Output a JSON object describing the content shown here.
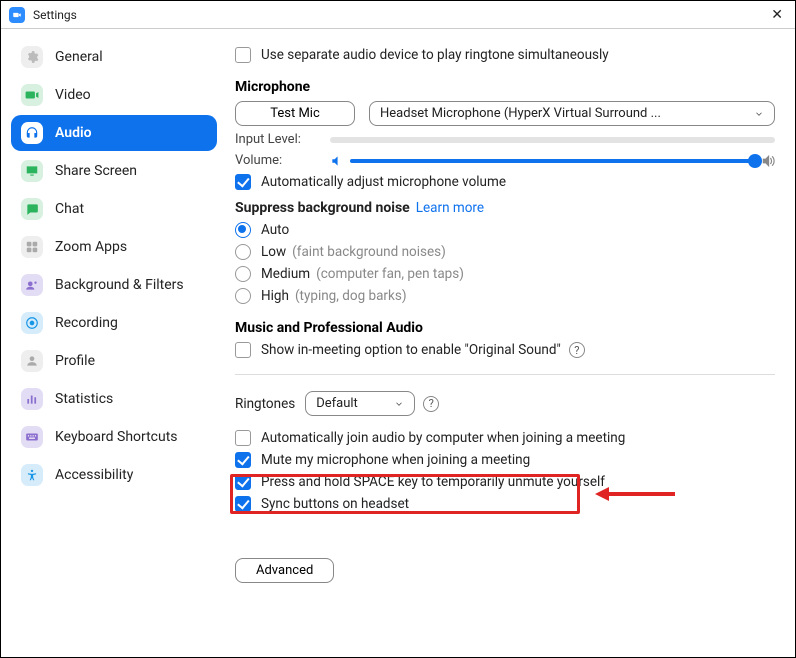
{
  "window": {
    "title": "Settings"
  },
  "sidebar": {
    "items": [
      {
        "name": "general",
        "label": "General"
      },
      {
        "name": "video",
        "label": "Video"
      },
      {
        "name": "audio",
        "label": "Audio"
      },
      {
        "name": "share",
        "label": "Share Screen"
      },
      {
        "name": "chat",
        "label": "Chat"
      },
      {
        "name": "apps",
        "label": "Zoom Apps"
      },
      {
        "name": "bgfilters",
        "label": "Background & Filters"
      },
      {
        "name": "recording",
        "label": "Recording"
      },
      {
        "name": "profile",
        "label": "Profile"
      },
      {
        "name": "stats",
        "label": "Statistics"
      },
      {
        "name": "keyboard",
        "label": "Keyboard Shortcuts"
      },
      {
        "name": "access",
        "label": "Accessibility"
      }
    ]
  },
  "audio": {
    "separate_ringtone_label": "Use separate audio device to play ringtone simultaneously",
    "microphone_section": "Microphone",
    "test_mic_label": "Test Mic",
    "mic_device": "Headset Microphone (HyperX Virtual Surround ...",
    "input_level_label": "Input Level:",
    "volume_label": "Volume:",
    "auto_adjust_label": "Automatically adjust microphone volume",
    "suppress_title": "Suppress background noise",
    "learn_more": "Learn more",
    "suppress_options": {
      "auto": {
        "label": "Auto",
        "hint": ""
      },
      "low": {
        "label": "Low",
        "hint": "(faint background noises)"
      },
      "medium": {
        "label": "Medium",
        "hint": "(computer fan, pen taps)"
      },
      "high": {
        "label": "High",
        "hint": "(typing, dog barks)"
      }
    },
    "music_title": "Music and Professional Audio",
    "original_sound_label": "Show in-meeting option to enable \"Original Sound\"",
    "ringtones_label": "Ringtones",
    "ringtone_value": "Default",
    "auto_join_label": "Automatically join audio by computer when joining a meeting",
    "mute_on_join_label": "Mute my microphone when joining a meeting",
    "space_unmute_label": "Press and hold SPACE key to temporarily unmute yourself",
    "sync_headset_label": "Sync buttons on headset",
    "advanced_label": "Advanced"
  }
}
